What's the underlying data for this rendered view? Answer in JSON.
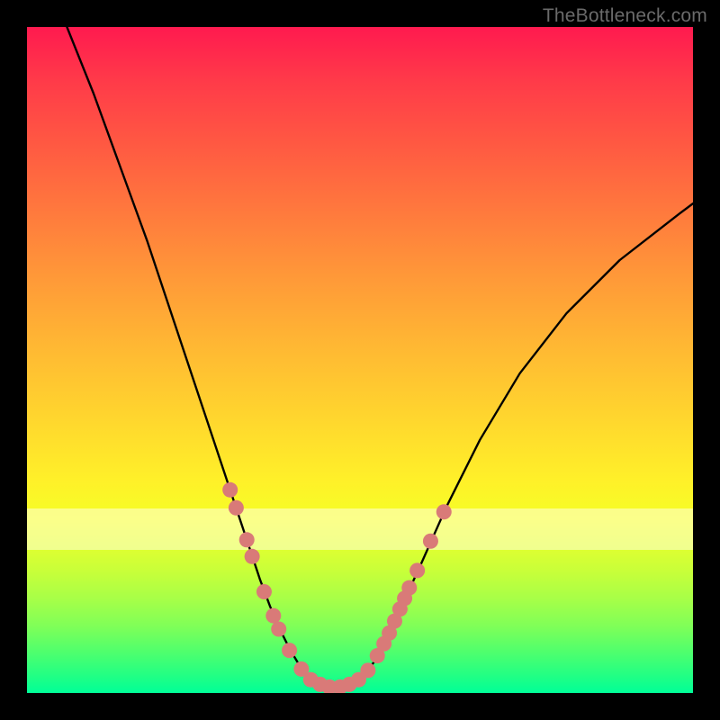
{
  "watermark": "TheBottleneck.com",
  "chart_data": {
    "type": "line",
    "title": "",
    "xlabel": "",
    "ylabel": "",
    "xlim": [
      0,
      100
    ],
    "ylim": [
      0,
      100
    ],
    "grid": false,
    "legend": false,
    "description": "Bottleneck-style V-curve over a vertical rainbow gradient (red top to green bottom). Two black curve branches descend from upper-left and upper-right meeting near the bottom center. Salmon dotted markers highlight the lower segments of each branch.",
    "series": [
      {
        "name": "left-branch",
        "color": "#000000",
        "x": [
          6,
          10,
          14,
          18,
          22,
          24,
          26,
          28,
          30,
          32,
          33.5,
          35,
          36.5,
          38,
          39.5,
          41,
          42.5
        ],
        "y": [
          100,
          90,
          79,
          68,
          56,
          50,
          44,
          38,
          32,
          26,
          21.5,
          17,
          13,
          9.5,
          6.5,
          4,
          2.2
        ]
      },
      {
        "name": "valley",
        "color": "#000000",
        "x": [
          42.5,
          44,
          45.5,
          47,
          48.5,
          50
        ],
        "y": [
          2.2,
          1.2,
          0.8,
          0.8,
          1.2,
          2.2
        ]
      },
      {
        "name": "right-branch",
        "color": "#000000",
        "x": [
          50,
          52,
          54,
          56,
          59,
          63,
          68,
          74,
          81,
          89,
          98,
          100
        ],
        "y": [
          2.2,
          4.5,
          8,
          12.5,
          19,
          28,
          38,
          48,
          57,
          65,
          72,
          73.5
        ]
      }
    ],
    "markers": [
      {
        "name": "left-dots",
        "color": "#d97a78",
        "radius_pct": 1.15,
        "points": [
          {
            "x": 30.5,
            "y": 30.5
          },
          {
            "x": 31.4,
            "y": 27.8
          },
          {
            "x": 33.0,
            "y": 23.0
          },
          {
            "x": 33.8,
            "y": 20.5
          },
          {
            "x": 35.6,
            "y": 15.2
          },
          {
            "x": 37.0,
            "y": 11.6
          },
          {
            "x": 37.8,
            "y": 9.6
          },
          {
            "x": 39.4,
            "y": 6.4
          },
          {
            "x": 41.2,
            "y": 3.6
          }
        ]
      },
      {
        "name": "valley-dots",
        "color": "#d97a78",
        "radius_pct": 1.15,
        "points": [
          {
            "x": 42.6,
            "y": 2.0
          },
          {
            "x": 44.0,
            "y": 1.3
          },
          {
            "x": 45.4,
            "y": 0.9
          },
          {
            "x": 47.0,
            "y": 0.9
          },
          {
            "x": 48.4,
            "y": 1.3
          },
          {
            "x": 49.8,
            "y": 2.0
          }
        ]
      },
      {
        "name": "right-dots",
        "color": "#d97a78",
        "radius_pct": 1.15,
        "points": [
          {
            "x": 51.2,
            "y": 3.4
          },
          {
            "x": 52.6,
            "y": 5.6
          },
          {
            "x": 53.6,
            "y": 7.4
          },
          {
            "x": 54.4,
            "y": 9.0
          },
          {
            "x": 55.2,
            "y": 10.8
          },
          {
            "x": 56.0,
            "y": 12.6
          },
          {
            "x": 56.7,
            "y": 14.2
          },
          {
            "x": 57.4,
            "y": 15.8
          },
          {
            "x": 58.6,
            "y": 18.4
          },
          {
            "x": 60.6,
            "y": 22.8
          },
          {
            "x": 62.6,
            "y": 27.2
          }
        ]
      }
    ]
  }
}
